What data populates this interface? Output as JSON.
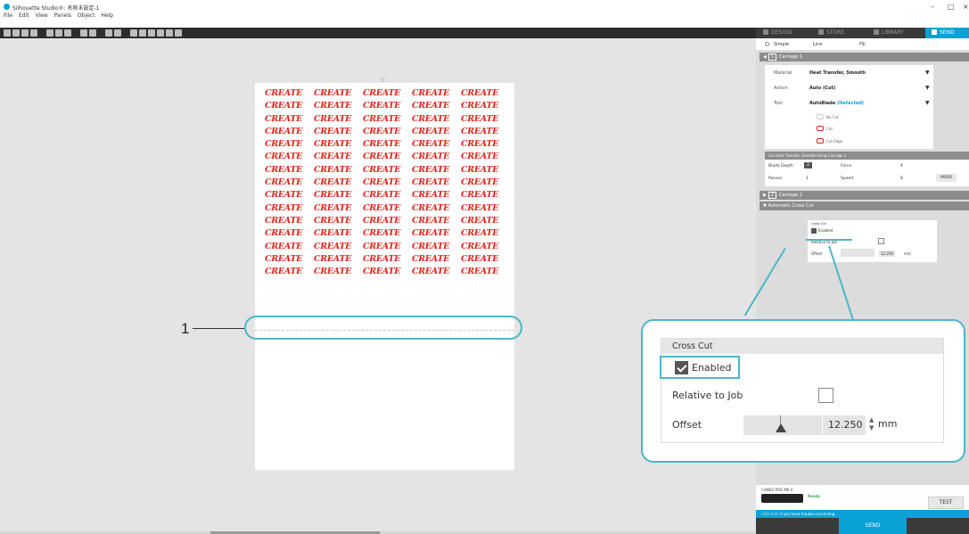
{
  "window": {
    "title": "Silhouette Studio®: 名称未設定-1",
    "menu": [
      "File",
      "Edit",
      "View",
      "Panels",
      "Object",
      "Help"
    ],
    "controls": {
      "minimize": "–",
      "maximize": "□",
      "close": "×"
    }
  },
  "toolbar": {
    "icons": [
      "new-icon",
      "open-icon",
      "save-icon",
      "print-icon",
      "cut-icon",
      "copy-icon",
      "paste-icon",
      "undo-icon",
      "redo-icon",
      "select-icon",
      "delete-icon",
      "zoom-in-icon",
      "zoom-out-icon",
      "zoom-fit-icon",
      "pan-icon",
      "hand-icon",
      "grid-icon"
    ]
  },
  "canvas": {
    "word": "CREATE",
    "rows": 15,
    "cols": 5,
    "callout_number": "1"
  },
  "right_panel": {
    "tabs": [
      "DESIGN",
      "STORE",
      "LIBRARY",
      "SEND"
    ],
    "active_tab": "SEND",
    "modes": [
      "Simple",
      "Line",
      "Fill"
    ],
    "carriage1_label": "Carriage 1",
    "carriage1_num": "1",
    "material_label": "Material",
    "material_value": "Heat Transfer, Smooth",
    "action_label": "Action",
    "action_value": "Auto (Cut)",
    "tool_label": "Tool",
    "tool_value": "AutoBlade",
    "tool_detected": "(Detected)",
    "cut_options": [
      "No Cut",
      "Cut",
      "Cut Edge"
    ],
    "cut_settings_header": "Cut Heat Transfer, Smooth Using Carriage 1",
    "blade_depth_label": "Blade Depth",
    "blade_depth_value": "2",
    "force_label": "Force",
    "force_value": "4",
    "passes_label": "Passes",
    "passes_value": "1",
    "speed_label": "Speed",
    "speed_value": "8",
    "more_label": "MORE",
    "carriage2_label": "Carriage 2",
    "carriage2_num": "2",
    "auto_cross_cut_label": "Automatic Cross Cut",
    "cross_cut_small": {
      "title": "Cross Cut",
      "enabled": "Enabled",
      "relative": "Relative to Job",
      "offset": "Offset",
      "offset_value": "12.250",
      "unit": "mm"
    },
    "device_name": "CAMEO PRO MK II",
    "device_status": "Ready",
    "test_label": "TEST",
    "help_link": "Click here",
    "help_text": " if you have trouble connecting.",
    "send_label": "SEND"
  },
  "zoom": {
    "header": "Cross Cut",
    "enabled_label": "Enabled",
    "enabled_checked": true,
    "relative_label": "Relative to Job",
    "relative_checked": false,
    "offset_label": "Offset",
    "offset_value": "12.250",
    "offset_unit": "mm"
  },
  "colors": {
    "accent": "#0aa2d6",
    "highlight": "#4cb6c9",
    "create_red": "#e2231a",
    "status_green": "#38b044"
  }
}
